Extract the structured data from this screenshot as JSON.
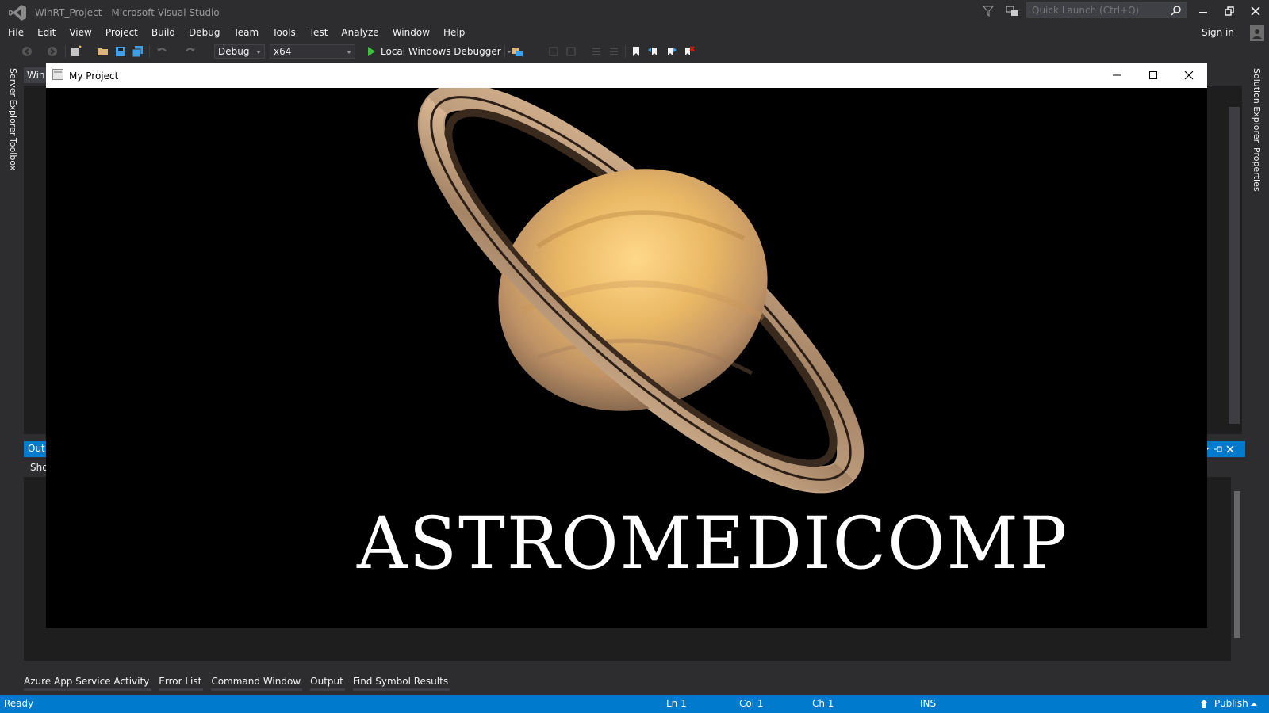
{
  "window": {
    "title": "WinRT_Project - Microsoft Visual Studio",
    "quick_launch_placeholder": "Quick Launch (Ctrl+Q)",
    "sign_in": "Sign in"
  },
  "menu": [
    "File",
    "Edit",
    "View",
    "Project",
    "Build",
    "Debug",
    "Team",
    "Tools",
    "Test",
    "Analyze",
    "Window",
    "Help"
  ],
  "toolbar": {
    "configuration": "Debug",
    "platform": "x64",
    "debugger": "Local Windows Debugger"
  },
  "side_panels": {
    "left": [
      "Server Explorer",
      "Toolbox"
    ],
    "right": [
      "Solution Explorer",
      "Properties"
    ]
  },
  "document": {
    "tab_label": "Win"
  },
  "output_panel": {
    "title": "Out",
    "show_output_label": "Sho"
  },
  "bottom_tabs": [
    "Azure App Service Activity",
    "Error List",
    "Command Window",
    "Output",
    "Find Symbol Results"
  ],
  "status_bar": {
    "state": "Ready",
    "line": "Ln 1",
    "column": "Col 1",
    "char": "Ch 1",
    "mode": "INS",
    "publish": "Publish"
  },
  "app_window": {
    "title": "My Project",
    "content_text": "ASTROMEDICOMP",
    "image_subject": "planet-saturn"
  },
  "colors": {
    "ide_background": "#2d2d30",
    "accent": "#007acc",
    "app_canvas": "#000000",
    "text": "#f1f1f1"
  }
}
